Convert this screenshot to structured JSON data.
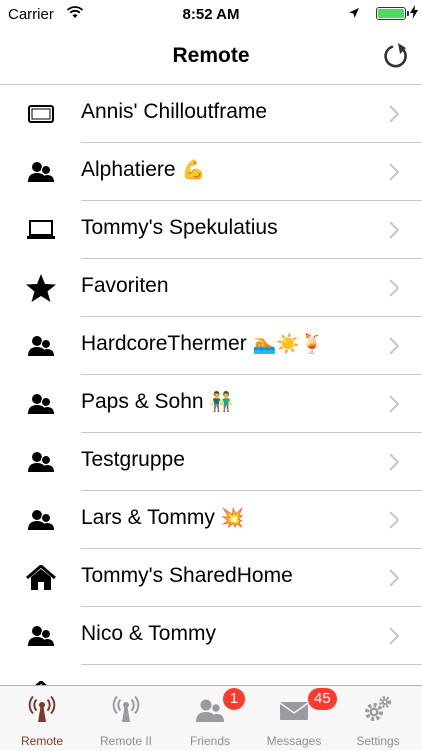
{
  "status_bar": {
    "carrier": "Carrier",
    "time": "8:52 AM"
  },
  "nav": {
    "title": "Remote",
    "refresh_icon": "refresh-icon"
  },
  "rows": [
    {
      "icon": "tablet-icon",
      "label": "Annis' Chilloutframe",
      "emoji": ""
    },
    {
      "icon": "group-icon",
      "label": "Alphatiere",
      "emoji": "💪"
    },
    {
      "icon": "laptop-icon",
      "label": "Tommy's Spekulatius",
      "emoji": ""
    },
    {
      "icon": "star-icon",
      "label": "Favoriten",
      "emoji": ""
    },
    {
      "icon": "group-icon",
      "label": "HardcoreThermer",
      "emoji": "🏊☀️🍹"
    },
    {
      "icon": "group-icon",
      "label": "Paps & Sohn",
      "emoji": "👬"
    },
    {
      "icon": "group-icon",
      "label": "Testgruppe",
      "emoji": ""
    },
    {
      "icon": "group-icon",
      "label": "Lars & Tommy",
      "emoji": "💥"
    },
    {
      "icon": "home-icon",
      "label": "Tommy's SharedHome",
      "emoji": ""
    },
    {
      "icon": "group-icon",
      "label": "Nico & Tommy",
      "emoji": ""
    }
  ],
  "tabs": [
    {
      "label": "Remote",
      "icon": "antenna-icon",
      "active": true
    },
    {
      "label": "Remote II",
      "icon": "antenna-icon",
      "active": false
    },
    {
      "label": "Friends",
      "icon": "friends-icon",
      "active": false,
      "badge": "1"
    },
    {
      "label": "Messages",
      "icon": "envelope-icon",
      "active": false,
      "badge": "45"
    },
    {
      "label": "Settings",
      "icon": "gears-icon",
      "active": false
    }
  ],
  "colors": {
    "active_tab": "#7a3b2b",
    "inactive_tab": "#8e8e93",
    "badge": "#ff3b30",
    "separator": "#c8c7cc",
    "battery": "#4cd964"
  }
}
